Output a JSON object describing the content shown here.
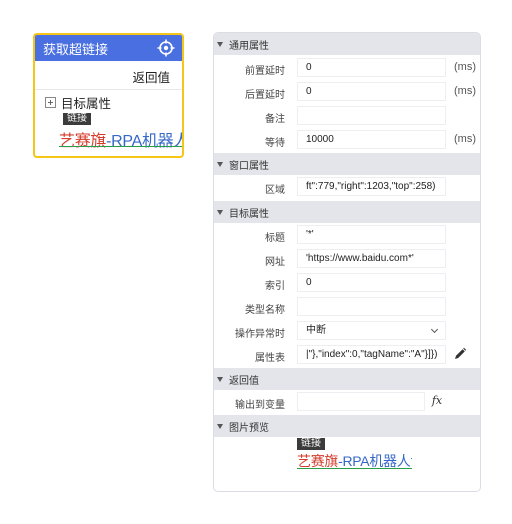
{
  "activity": {
    "title": "获取超链接",
    "target_icon": "crosshair-target-icon",
    "return_label": "返回值",
    "target_label": "目标属性",
    "expand_icon": "plus-box-icon",
    "border_color": "#f5c518",
    "header_color": "#4a6fe0"
  },
  "preview": {
    "badge": "链接",
    "text_part1": "艺赛旗",
    "text_part2": "-RPA机器人专"
  },
  "panel": {
    "sections": {
      "general": "通用属性",
      "window": "窗口属性",
      "target": "目标属性",
      "return": "返回值",
      "image": "图片预览"
    },
    "general": {
      "pre_delay": {
        "label": "前置延时",
        "value": "0",
        "unit": "(ms)"
      },
      "post_delay": {
        "label": "后置延时",
        "value": "0",
        "unit": "(ms)"
      },
      "note": {
        "label": "备注",
        "value": ""
      },
      "wait": {
        "label": "等待",
        "value": "10000",
        "unit": "(ms)"
      }
    },
    "window": {
      "region": {
        "label": "区域",
        "value": "ft\":779,\"right\":1203,\"top\":258)"
      }
    },
    "target": {
      "title": {
        "label": "标题",
        "value": "'*'"
      },
      "url": {
        "label": "网址",
        "value": "'https://www.baidu.com*'"
      },
      "index": {
        "label": "索引",
        "value": "0"
      },
      "type_name": {
        "label": "类型名称",
        "value": ""
      },
      "on_error": {
        "label": "操作异常时",
        "value": "中断"
      },
      "attributes": {
        "label": "属性表",
        "value": "|\"},\"index\":0,\"tagName\":\"A\"}]})"
      }
    },
    "return": {
      "output": {
        "label": "输出到变量",
        "value": "",
        "button": "fx"
      }
    }
  }
}
